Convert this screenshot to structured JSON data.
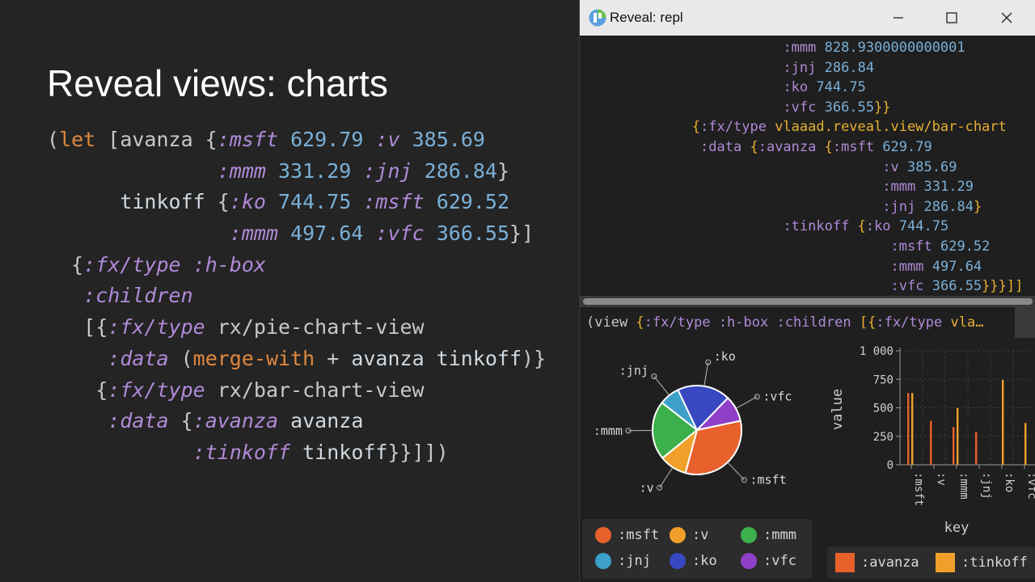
{
  "slide": {
    "title": "Reveal views: charts",
    "code_lines": [
      [
        [
          "p",
          "("
        ],
        [
          "kw",
          "let"
        ],
        [
          "p",
          " [avanza {"
        ],
        [
          "sy",
          ":msft"
        ],
        [
          "p",
          " "
        ],
        [
          "nm",
          "629.79"
        ],
        [
          "p",
          " "
        ],
        [
          "sy",
          ":v"
        ],
        [
          "p",
          " "
        ],
        [
          "nm",
          "385.69"
        ]
      ],
      [
        [
          "p",
          "              "
        ],
        [
          "sy",
          ":mmm"
        ],
        [
          "p",
          " "
        ],
        [
          "nm",
          "331.29"
        ],
        [
          "p",
          " "
        ],
        [
          "sy",
          ":jnj"
        ],
        [
          "p",
          " "
        ],
        [
          "nm",
          "286.84"
        ],
        [
          "p",
          "}"
        ]
      ],
      [
        [
          "p",
          "      "
        ],
        [
          "id",
          "tinkoff"
        ],
        [
          "p",
          " {"
        ],
        [
          "sy",
          ":ko"
        ],
        [
          "p",
          " "
        ],
        [
          "nm",
          "744.75"
        ],
        [
          "p",
          " "
        ],
        [
          "sy",
          ":msft"
        ],
        [
          "p",
          " "
        ],
        [
          "nm",
          "629.52"
        ]
      ],
      [
        [
          "p",
          "               "
        ],
        [
          "sy",
          ":mmm"
        ],
        [
          "p",
          " "
        ],
        [
          "nm",
          "497.64"
        ],
        [
          "p",
          " "
        ],
        [
          "sy",
          ":vfc"
        ],
        [
          "p",
          " "
        ],
        [
          "nm",
          "366.55"
        ],
        [
          "p",
          "}]"
        ]
      ],
      [
        [
          "p",
          "  {"
        ],
        [
          "sy",
          ":fx/type"
        ],
        [
          "p",
          " "
        ],
        [
          "sy",
          ":h-box"
        ]
      ],
      [
        [
          "p",
          "   "
        ],
        [
          "sy",
          ":children"
        ]
      ],
      [
        [
          "p",
          "   [{"
        ],
        [
          "sy",
          ":fx/type"
        ],
        [
          "p",
          " rx/pie-chart-view"
        ]
      ],
      [
        [
          "p",
          "     "
        ],
        [
          "sy",
          ":data"
        ],
        [
          "p",
          " ("
        ],
        [
          "kw",
          "merge-with"
        ],
        [
          "p",
          " + "
        ],
        [
          "id",
          "avanza tinkoff"
        ],
        [
          "p",
          ")}"
        ]
      ],
      [
        [
          "p",
          "    {"
        ],
        [
          "sy",
          ":fx/type"
        ],
        [
          "p",
          " rx/bar-chart-view"
        ]
      ],
      [
        [
          "p",
          "     "
        ],
        [
          "sy",
          ":data"
        ],
        [
          "p",
          " {"
        ],
        [
          "sy",
          ":avanza"
        ],
        [
          "p",
          " "
        ],
        [
          "id",
          "avanza"
        ]
      ],
      [
        [
          "p",
          "            "
        ],
        [
          "sy",
          ":tinkoff"
        ],
        [
          "p",
          " "
        ],
        [
          "id",
          "tinkoff"
        ],
        [
          "p",
          "}}]])"
        ]
      ]
    ]
  },
  "window": {
    "title": "Reveal: repl",
    "buttons": {
      "minimize": "minimize",
      "maximize": "maximize",
      "close": "close"
    },
    "repl_lines": [
      {
        "col": 31,
        "parts": [
          [
            "k",
            ":mmm"
          ],
          [
            "t",
            " "
          ],
          [
            "n",
            "828.9300000000001"
          ]
        ]
      },
      {
        "col": 31,
        "parts": [
          [
            "k",
            ":jnj"
          ],
          [
            "t",
            " "
          ],
          [
            "n",
            "286.84"
          ]
        ]
      },
      {
        "col": 31,
        "parts": [
          [
            "k",
            ":ko"
          ],
          [
            "t",
            " "
          ],
          [
            "n",
            "744.75"
          ]
        ]
      },
      {
        "col": 31,
        "parts": [
          [
            "k",
            ":vfc"
          ],
          [
            "t",
            " "
          ],
          [
            "n",
            "366.55"
          ],
          [
            "b",
            "}}"
          ]
        ]
      },
      {
        "col": 20,
        "parts": [
          [
            "b",
            "{"
          ],
          [
            "k",
            ":fx/type"
          ],
          [
            "t",
            " "
          ],
          [
            "b",
            "vlaaad.reveal.view/bar-chart"
          ]
        ]
      },
      {
        "col": 21,
        "parts": [
          [
            "k",
            ":data"
          ],
          [
            "t",
            " "
          ],
          [
            "b",
            "{"
          ],
          [
            "k",
            ":avanza"
          ],
          [
            "t",
            " "
          ],
          [
            "b",
            "{"
          ],
          [
            "k",
            ":msft"
          ],
          [
            "t",
            " "
          ],
          [
            "n",
            "629.79"
          ]
        ]
      },
      {
        "col": 43,
        "parts": [
          [
            "k",
            ":v"
          ],
          [
            "t",
            " "
          ],
          [
            "n",
            "385.69"
          ]
        ]
      },
      {
        "col": 43,
        "parts": [
          [
            "k",
            ":mmm"
          ],
          [
            "t",
            " "
          ],
          [
            "n",
            "331.29"
          ]
        ]
      },
      {
        "col": 43,
        "parts": [
          [
            "k",
            ":jnj"
          ],
          [
            "t",
            " "
          ],
          [
            "n",
            "286.84"
          ],
          [
            "b",
            "}"
          ]
        ]
      },
      {
        "col": 31,
        "parts": [
          [
            "k",
            ":tinkoff"
          ],
          [
            "t",
            " "
          ],
          [
            "b",
            "{"
          ],
          [
            "k",
            ":ko"
          ],
          [
            "t",
            " "
          ],
          [
            "n",
            "744.75"
          ]
        ]
      },
      {
        "col": 44,
        "parts": [
          [
            "k",
            ":msft"
          ],
          [
            "t",
            " "
          ],
          [
            "n",
            "629.52"
          ]
        ]
      },
      {
        "col": 44,
        "parts": [
          [
            "k",
            ":mmm"
          ],
          [
            "t",
            " "
          ],
          [
            "n",
            "497.64"
          ]
        ]
      },
      {
        "col": 44,
        "parts": [
          [
            "k",
            ":vfc"
          ],
          [
            "t",
            " "
          ],
          [
            "n",
            "366.55"
          ],
          [
            "b",
            "}}}]]"
          ]
        ]
      }
    ],
    "view_expr": [
      [
        "p",
        "(view "
      ],
      [
        "b",
        "{"
      ],
      [
        "k",
        ":fx/type"
      ],
      [
        "p",
        " "
      ],
      [
        "k",
        ":h-box"
      ],
      [
        "p",
        " "
      ],
      [
        "k",
        ":children"
      ],
      [
        "p",
        " "
      ],
      [
        "b",
        "[{"
      ],
      [
        "k",
        ":fx/type"
      ],
      [
        "p",
        " "
      ],
      [
        "b",
        "vla…"
      ]
    ]
  },
  "chart_data": [
    {
      "type": "pie",
      "categories": [
        ":msft",
        ":v",
        ":mmm",
        ":jnj",
        ":ko",
        ":vfc"
      ],
      "values": [
        1259.31,
        385.69,
        828.93,
        286.84,
        744.75,
        366.55
      ],
      "colors": [
        "#e8602c",
        "#f0a02a",
        "#3cb04a",
        "#3ca0c8",
        "#3848c0",
        "#9040c8"
      ],
      "legend_placement": "bottom"
    },
    {
      "type": "bar",
      "categories": [
        ":msft",
        ":v",
        ":mmm",
        ":jnj",
        ":ko",
        ":vfc"
      ],
      "series": [
        {
          "name": ":avanza",
          "values": [
            629.79,
            385.69,
            331.29,
            286.84,
            null,
            null
          ],
          "color": "#e8602c"
        },
        {
          "name": ":tinkoff",
          "values": [
            629.52,
            null,
            497.64,
            null,
            744.75,
            366.55
          ],
          "color": "#f0a02a"
        }
      ],
      "xlabel": "key",
      "ylabel": "value",
      "ylim": [
        0,
        1000
      ],
      "yticks": [
        "0",
        "250",
        "500",
        "750",
        "1 000"
      ],
      "legend_placement": "bottom"
    }
  ]
}
